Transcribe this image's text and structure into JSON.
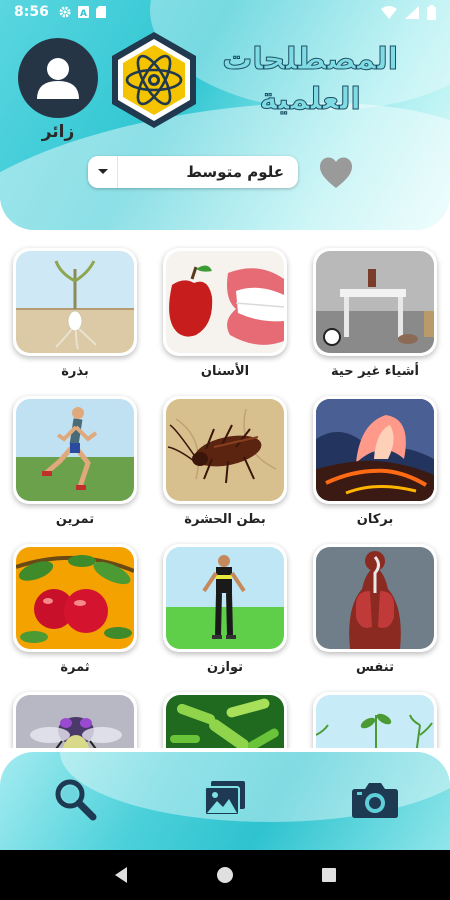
{
  "status_bar": {
    "time": "8:56"
  },
  "header": {
    "title_line1": "المصطلحات",
    "title_line2": "العلمية",
    "user_label": "زائر",
    "category_select": "علوم متوسط"
  },
  "terms": [
    {
      "label": "أشياء غير حية",
      "icon": "table-objects"
    },
    {
      "label": "الأسنان",
      "icon": "teeth-apple"
    },
    {
      "label": "بذرة",
      "icon": "seed"
    },
    {
      "label": "بركان",
      "icon": "volcano"
    },
    {
      "label": "بطن الحشرة",
      "icon": "cockroach"
    },
    {
      "label": "تمرين",
      "icon": "runner"
    },
    {
      "label": "تنفس",
      "icon": "lungs"
    },
    {
      "label": "توازن",
      "icon": "balance-man"
    },
    {
      "label": "ثمرة",
      "icon": "apples-fruit"
    }
  ],
  "icons": {
    "avatar": "person-icon",
    "logo": "atom-hexagon-logo",
    "favorite": "heart-icon",
    "dropdown": "caret-down-icon",
    "nav": [
      "search-icon",
      "gallery-icon",
      "camera-icon"
    ],
    "system": [
      "back-icon",
      "home-icon",
      "recents-icon"
    ]
  },
  "colors": {
    "header_teal": "#2fc6d2",
    "avatar_bg": "#263545",
    "logo_yellow": "#f5c400",
    "title_fill": "#7fdce5"
  }
}
